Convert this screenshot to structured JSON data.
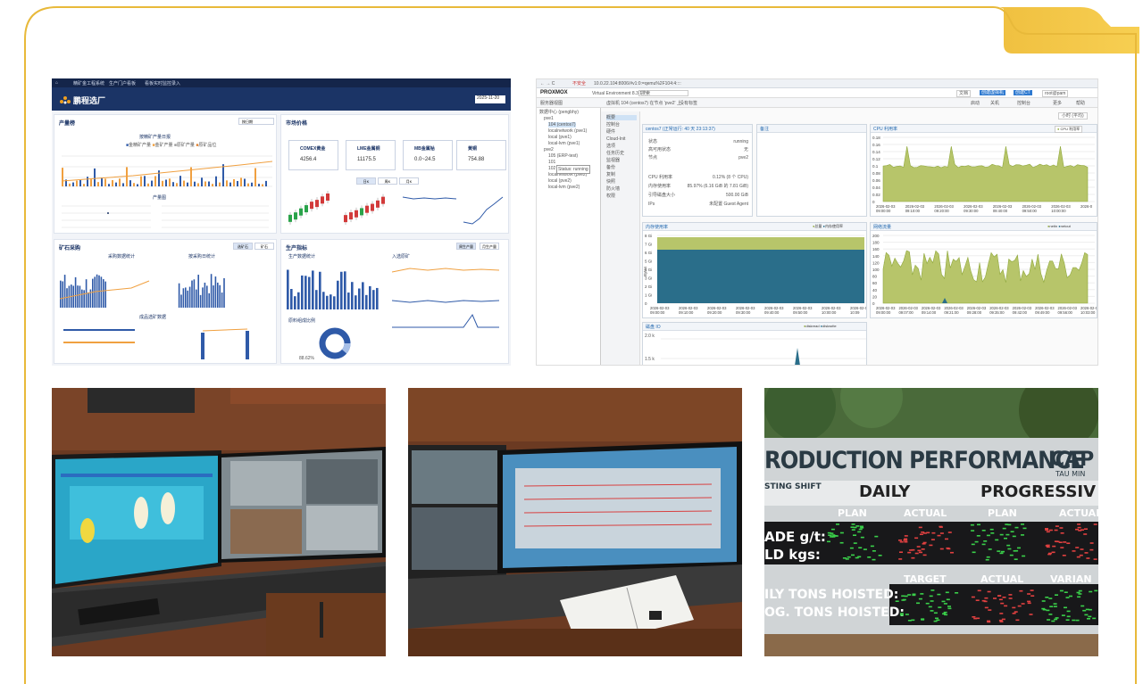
{
  "dashboard": {
    "nav_tabs": [
      "精矿金工程系统",
      "生产门户看板",
      "看板实时监控录入"
    ],
    "logo_text": "鹏程选厂",
    "date_value": "2025-11-20",
    "production_panel": {
      "title": "产量榜",
      "dropdown": "按日期",
      "chart_title": "按精矿产量日报",
      "legend": [
        "金精矿产量",
        "金矿产量",
        "原矿产量",
        "原矿品位"
      ],
      "sub_title": "产量图"
    },
    "market_panel": {
      "title": "市场价格",
      "prices": [
        {
          "name": "COMEX黄金",
          "value": "4256.4"
        },
        {
          "name": "LME金属铜",
          "value": "11175.5"
        },
        {
          "name": "MB金属钴",
          "value": "0.0~24.5"
        },
        {
          "name": "黄铜",
          "value": "754.88"
        }
      ],
      "period_tabs": [
        "日K",
        "周K",
        "月K"
      ]
    },
    "mining_panel": {
      "title": "矿石采购",
      "tabs": [
        "选矿石",
        "矿石"
      ],
      "chart_titles": [
        "采购数据统计",
        "按采购日统计"
      ],
      "sub_title": "成品选矿数据"
    },
    "output_panel": {
      "title": "生产指标",
      "tabs": [
        "周生产量",
        "月生产量"
      ],
      "chart_titles": [
        "生产数据统计",
        "入选原矿"
      ],
      "donut_title": "原料组成比例",
      "donut_label": "88.62%"
    }
  },
  "proxmox": {
    "address": "10.0.22.104:8006/#v1:0:=qemu%2F104:4::::",
    "security_label": "不安全",
    "brand": "PROXMOX",
    "version": "Virtual Environment 8.3.1",
    "search_placeholder": "搜索",
    "header_buttons": [
      "文档",
      "创建虚拟机",
      "创建CT",
      "root@pam"
    ],
    "crumb": "虚拟机 104 (centos7) 在节点 'pve2' 上",
    "crumb_tag": "没有标签",
    "action_buttons": [
      "启动",
      "关机",
      "控制台",
      "更多",
      "帮助"
    ],
    "time_select": "小时 (平均)",
    "tree_view": "服务器视图",
    "tree": [
      "数据中心 (pengbhy)",
      "pve1",
      "104 (centos7)",
      "localnetwork (pve1)",
      "local (pve1)",
      "local-lvm (pve1)",
      "pve2",
      "105 (ERP-test)",
      "101",
      "102",
      "localnetwork (pve2)",
      "local (pve2)",
      "local-lvm (pve2)"
    ],
    "tooltip": "Status: running",
    "menu": [
      "概要",
      "控制台",
      "硬件",
      "Cloud-Init",
      "选项",
      "任务历史",
      "监视器",
      "备份",
      "复制",
      "快照",
      "防火墙",
      "权限"
    ],
    "summary": {
      "title": "centos7 (正常运行: 40 天 23:13:37)",
      "rows": [
        {
          "label": "状态",
          "value": "running"
        },
        {
          "label": "高可用状态",
          "value": "无"
        },
        {
          "label": "节点",
          "value": "pve2"
        },
        {
          "label": "CPU 利用率",
          "value": "0.12% (8 个 CPU)"
        },
        {
          "label": "内存使用率",
          "value": "85.97% (6.16 GiB 的 7.81 GiB)"
        },
        {
          "label": "引导磁盘大小",
          "value": "500.00 GiB"
        },
        {
          "label": "IPs",
          "value": "未配置 Guest Agent"
        }
      ]
    },
    "notes_title": "备注",
    "cpu_chart": {
      "title": "CPU 利用率",
      "legend": "CPU 利用率",
      "y_ticks": [
        "0.18",
        "0.16",
        "0.14",
        "0.12",
        "0.1",
        "0.08",
        "0.06",
        "0.04",
        "0.02",
        "0"
      ],
      "x_ticks": [
        "2026-02-03\n09:00:00",
        "2026-02-03\n09:10:00",
        "2026-02-03\n09:20:00",
        "2026-02-03\n09:30:00",
        "2026-02-03\n09:40:00",
        "2026-02-03\n09:50:00",
        "2026-02-03\n10:00:00",
        "2026-0"
      ]
    },
    "mem_chart": {
      "title": "内存使用率",
      "legend": [
        "总量",
        "内存使用率"
      ],
      "y_ticks": [
        "8 Gi",
        "7 Gi",
        "6 Gi",
        "5 Gi",
        "4 Gi",
        "3 Gi",
        "2 Gi",
        "1 Gi",
        "0"
      ],
      "y_label": "Bytes",
      "x_ticks": [
        "2026-02-03\n09:00:00",
        "2026-02-03\n09:10:00",
        "2026-02-03\n09:20:00",
        "2026-02-03\n09:30:00",
        "2026-02-03\n09:40:00",
        "2026-02-03\n09:50:00",
        "2026-02-03\n10:00:00",
        "2026-02-03\n10:09"
      ]
    },
    "net_chart": {
      "title": "网络流量",
      "legend": [
        "netin",
        "netout"
      ],
      "y_ticks": [
        "200",
        "180",
        "160",
        "140",
        "120",
        "100",
        "80",
        "60",
        "40",
        "20",
        "0"
      ],
      "x_ticks": [
        "2026-02-03\n09:00:00",
        "2026-02-03\n09:07:00",
        "2026-02-03\n09:14:00",
        "2026-02-03\n09:21:00",
        "2026-02-03\n09:28:00",
        "2026-02-03\n09:35:00",
        "2026-02-03\n09:42:00",
        "2026-02-03\n09:49:00",
        "2026-02-03\n09:56:00",
        "2026-02-03\n10:03:00"
      ]
    },
    "disk_chart": {
      "title": "磁盘 IO",
      "legend": [
        "diskread",
        "diskwrite"
      ],
      "y_ticks": [
        "2.0 k",
        "1.5 k"
      ]
    }
  },
  "signboard": {
    "title": "RODUCTION PERFORMANCE",
    "brand": "CAP",
    "brand_sub": "TAU MIN",
    "shift": "STING SHIFT",
    "daily": "DAILY",
    "progressive": "PROGRESSIV",
    "cols": [
      "PLAN",
      "ACTUAL",
      "PLAN",
      "ACTUAL"
    ],
    "rows": [
      "ADE g/t:",
      "LD kgs:"
    ],
    "cols2": [
      "TARGET",
      "ACTUAL",
      "VARIAN"
    ],
    "rows2": [
      "ILY TONS HOISTED:",
      "OG. TONS HOISTED:"
    ]
  }
}
